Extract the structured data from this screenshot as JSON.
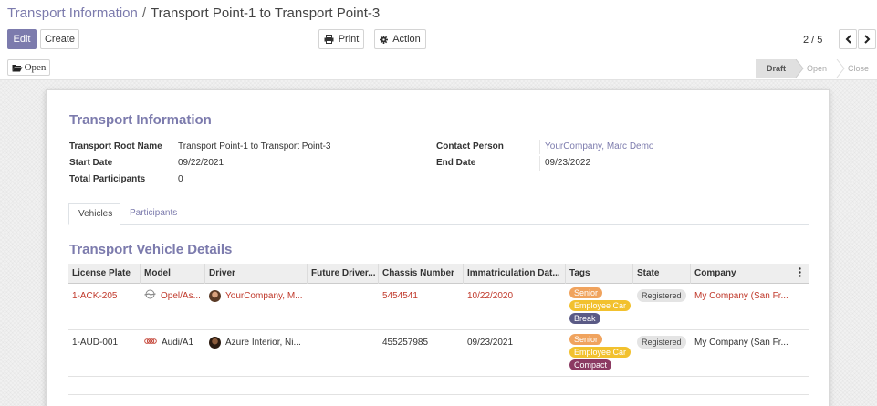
{
  "breadcrumb": {
    "parent": "Transport Information",
    "separator": "/",
    "current": "Transport Point-1 to Transport Point-3"
  },
  "toolbar": {
    "edit_label": "Edit",
    "create_label": "Create",
    "print_label": "Print",
    "action_label": "Action",
    "open_label": "Open"
  },
  "pager": {
    "value": "2 / 5"
  },
  "status_bar": {
    "stages": [
      "Draft",
      "Open",
      "Close"
    ],
    "active": "Draft"
  },
  "form": {
    "title": "Transport Information",
    "fields": {
      "root_name_label": "Transport Root Name",
      "root_name_value": "Transport Point-1 to Transport Point-3",
      "start_date_label": "Start Date",
      "start_date_value": "09/22/2021",
      "total_participants_label": "Total Participants",
      "total_participants_value": "0",
      "contact_person_label": "Contact Person",
      "contact_person_value": "YourCompany, Marc Demo",
      "end_date_label": "End Date",
      "end_date_value": "09/23/2022"
    },
    "tabs": [
      "Vehicles",
      "Participants"
    ],
    "active_tab": "Vehicles",
    "section_title": "Transport Vehicle Details"
  },
  "vehicles": {
    "columns": [
      "License Plate",
      "Model",
      "Driver",
      "Future Driver...",
      "Chassis Number",
      "Immatriculation Dat...",
      "Tags",
      "State",
      "Company"
    ],
    "rows": [
      {
        "license_plate": "1-ACK-205",
        "model": "Opel/As...",
        "driver": "YourCompany, M...",
        "future_driver": "",
        "chassis": "5454541",
        "immatriculation": "10/22/2020",
        "tags": [
          "Senior",
          "Employee Car",
          "Break"
        ],
        "state": "Registered",
        "company": "My Company (San Fr..."
      },
      {
        "license_plate": "1-AUD-001",
        "model": "Audi/A1",
        "driver": "Azure Interior, Ni...",
        "future_driver": "",
        "chassis": "455257985",
        "immatriculation": "09/23/2021",
        "tags": [
          "Senior",
          "Employee Car",
          "Compact"
        ],
        "state": "Registered",
        "company": "My Company (San Fr..."
      }
    ]
  },
  "colors": {
    "brand": "#7c7bad",
    "warning_text": "#c0392b",
    "tag_senior": "#f0a35e",
    "tag_employee_car": "#f2c12e",
    "tag_break": "#5a5a85",
    "tag_compact": "#8b3a62"
  },
  "icons": {
    "print": "print-icon",
    "action": "gear-icon",
    "open": "folder-open-icon",
    "prev": "chevron-left-icon",
    "next": "chevron-right-icon",
    "options": "kebab-icon"
  }
}
